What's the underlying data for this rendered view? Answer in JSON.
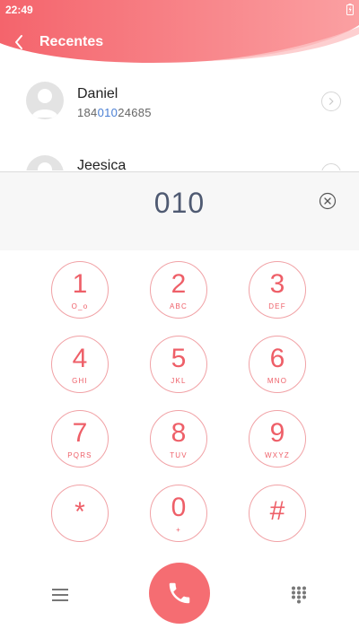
{
  "status": {
    "time": "22:49",
    "battery_icon": "battery-charging-icon"
  },
  "header": {
    "title": "Recentes",
    "back_icon": "chevron-left-icon",
    "gradient": [
      "#f4646c",
      "#fca5a5"
    ]
  },
  "contacts": [
    {
      "name": "Daniel",
      "number_prefix": "184",
      "number_match": "010",
      "number_suffix": "24685"
    },
    {
      "name": "Jeesica"
    }
  ],
  "dialer": {
    "typed": "010",
    "clear_icon": "clear-circle-icon",
    "keys": [
      {
        "digit": "1",
        "letters": "O_o"
      },
      {
        "digit": "2",
        "letters": "ABC"
      },
      {
        "digit": "3",
        "letters": "DEF"
      },
      {
        "digit": "4",
        "letters": "GHI"
      },
      {
        "digit": "5",
        "letters": "JKL"
      },
      {
        "digit": "6",
        "letters": "MNO"
      },
      {
        "digit": "7",
        "letters": "PQRS"
      },
      {
        "digit": "8",
        "letters": "TUV"
      },
      {
        "digit": "9",
        "letters": "WXYZ"
      },
      {
        "digit": "*",
        "letters": ""
      },
      {
        "digit": "0",
        "letters": "+"
      },
      {
        "digit": "#",
        "letters": ""
      }
    ]
  },
  "bottom": {
    "menu_icon": "menu-icon",
    "call_icon": "phone-icon",
    "dialpad_icon": "dialpad-icon"
  },
  "colors": {
    "accent": "#ee5f68",
    "call": "#f56d72",
    "key_border": "#f1a2a6",
    "highlight": "#4a7fd4"
  }
}
